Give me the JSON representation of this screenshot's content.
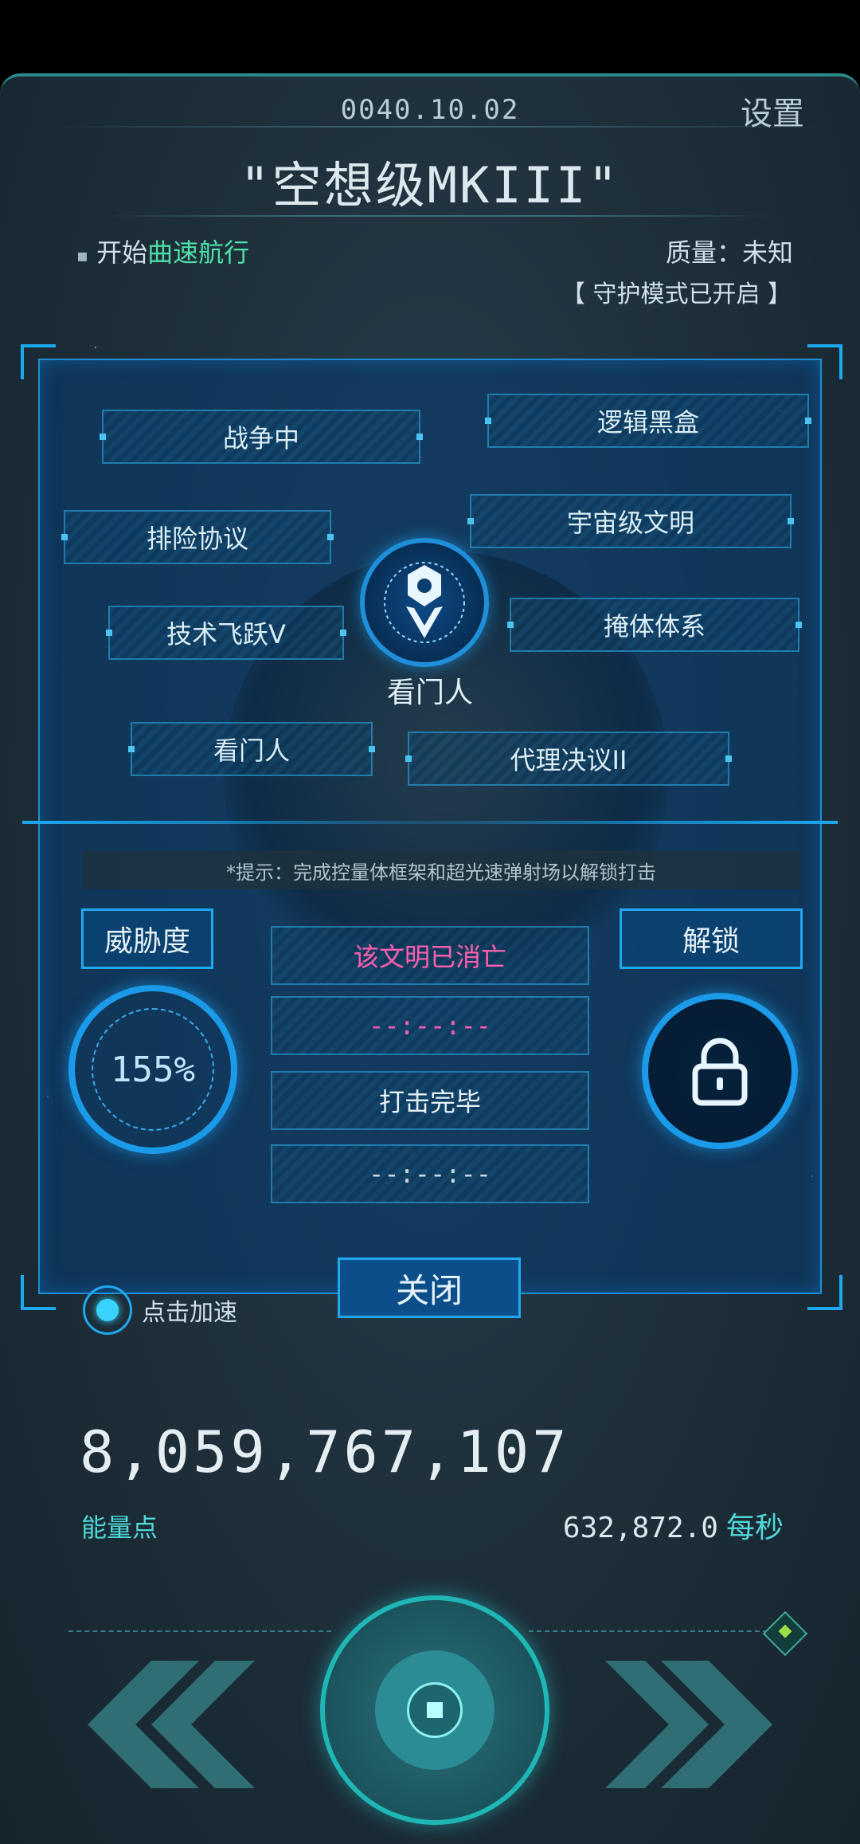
{
  "header": {
    "date": "0040.10.02",
    "settings_label": "设置",
    "ship_name": "\"空想级MKIII\"",
    "warp_prefix": "开始",
    "warp_highlight": "曲速航行",
    "quality": "质量：未知",
    "guard_mode": "【 守护模式已开启 】"
  },
  "dialog": {
    "chips": [
      {
        "label": "战争中"
      },
      {
        "label": "逻辑黑盒"
      },
      {
        "label": "排险协议"
      },
      {
        "label": "宇宙级文明"
      },
      {
        "label": "技术飞跃V"
      },
      {
        "label": "掩体体系"
      },
      {
        "label": "看门人"
      },
      {
        "label": "代理决议II"
      }
    ],
    "center_label": "看门人",
    "tip": "*提示：完成控量体框架和超光速弹射场以解锁打击",
    "threat_label": "威胁度",
    "threat_value": "155%",
    "unlock_label": "解锁",
    "status_rows": [
      {
        "text": "该文明已消亡",
        "color": "#ff5fb0"
      },
      {
        "text": "--:--:--",
        "color": "#ff5fb0"
      },
      {
        "text": "打击完毕",
        "color": "#e6f2f8"
      },
      {
        "text": "--:--:--",
        "color": "#c8d8e0"
      }
    ],
    "close_label": "关闭"
  },
  "accelerate_label": "点击加速",
  "energy": {
    "value": "8,059,767,107",
    "label": "能量点",
    "rate_value": "632,872.0",
    "rate_unit": "每秒"
  },
  "icons": {
    "center_emblem": "watchman-emblem-icon",
    "lock": "lock-icon",
    "prev": "double-chevron-left-icon",
    "next": "double-chevron-right-icon"
  },
  "colors": {
    "accent_blue": "#1ea8f0",
    "accent_teal": "#4fd8d8",
    "highlight_green": "#4fe0a8",
    "extinct_pink": "#ff5fb0"
  }
}
